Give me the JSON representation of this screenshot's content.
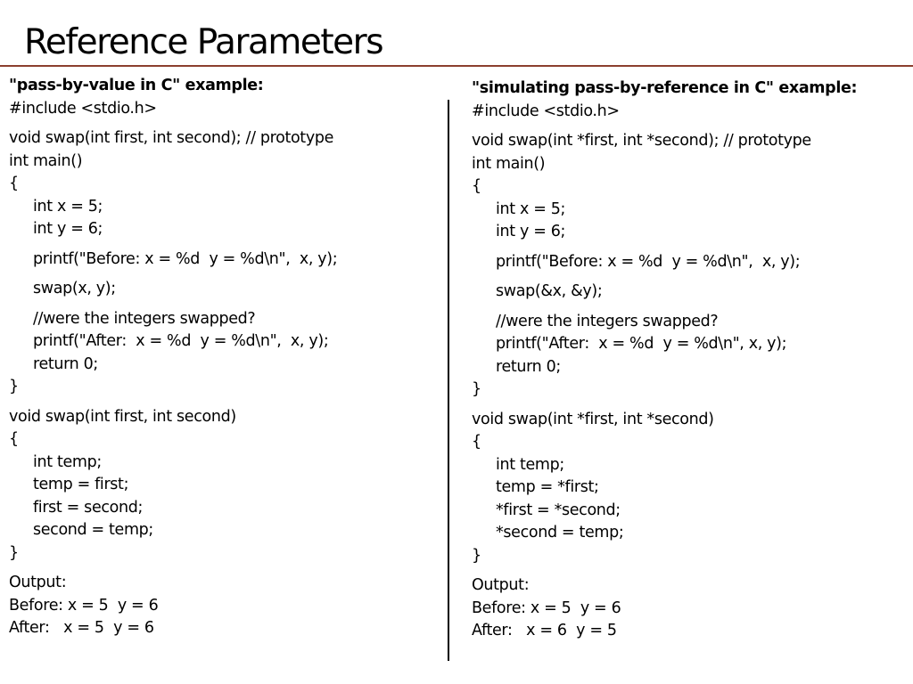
{
  "slide": {
    "title": "Reference Parameters",
    "colors": {
      "title_rule": "#8b3f2e",
      "text": "#000000",
      "background": "#ffffff"
    }
  },
  "columns": [
    {
      "heading": "\"pass-by-value in C\" example:",
      "lines": [
        {
          "text": "#include <stdio.h>",
          "indent": 0,
          "gap": false
        },
        {
          "text": "void swap(int first, int second); // prototype",
          "indent": 0,
          "gap": true
        },
        {
          "text": "int main()",
          "indent": 0,
          "gap": false
        },
        {
          "text": "{",
          "indent": 0,
          "gap": false
        },
        {
          "text": "int x = 5;",
          "indent": 1,
          "gap": false
        },
        {
          "text": "int y = 6;",
          "indent": 1,
          "gap": false
        },
        {
          "text": "printf(\"Before: x = %d  y = %d\\n\",  x, y);",
          "indent": 1,
          "gap": true
        },
        {
          "text": "swap(x, y);",
          "indent": 1,
          "gap": true
        },
        {
          "text": "//were the integers swapped?",
          "indent": 1,
          "gap": true
        },
        {
          "text": "printf(\"After:  x = %d  y = %d\\n\",  x, y);",
          "indent": 1,
          "gap": false
        },
        {
          "text": "return 0;",
          "indent": 1,
          "gap": false
        },
        {
          "text": "}",
          "indent": 0,
          "gap": false
        },
        {
          "text": "void swap(int first, int second)",
          "indent": 0,
          "gap": true
        },
        {
          "text": "{",
          "indent": 0,
          "gap": false
        },
        {
          "text": "int temp;",
          "indent": 1,
          "gap": false
        },
        {
          "text": "temp = first;",
          "indent": 1,
          "gap": false
        },
        {
          "text": "first = second;",
          "indent": 1,
          "gap": false
        },
        {
          "text": "second = temp;",
          "indent": 1,
          "gap": false
        },
        {
          "text": "}",
          "indent": 0,
          "gap": false
        },
        {
          "text": "Output:",
          "indent": 0,
          "gap": true
        },
        {
          "text": "Before: x = 5  y = 6",
          "indent": 0,
          "gap": false
        },
        {
          "text": "After:   x = 5  y = 6",
          "indent": 0,
          "gap": false
        }
      ]
    },
    {
      "heading": "\"simulating pass-by-reference in C\" example:",
      "lines": [
        {
          "text": "#include <stdio.h>",
          "indent": 0,
          "gap": false
        },
        {
          "text": "void swap(int *first, int *second); // prototype",
          "indent": 0,
          "gap": true
        },
        {
          "text": "int main()",
          "indent": 0,
          "gap": false
        },
        {
          "text": "{",
          "indent": 0,
          "gap": false
        },
        {
          "text": "int x = 5;",
          "indent": 1,
          "gap": false
        },
        {
          "text": "int y = 6;",
          "indent": 1,
          "gap": false
        },
        {
          "text": "printf(\"Before: x = %d  y = %d\\n\",  x, y);",
          "indent": 1,
          "gap": true
        },
        {
          "text": "swap(&x, &y);",
          "indent": 1,
          "gap": true
        },
        {
          "text": "//were the integers swapped?",
          "indent": 1,
          "gap": true
        },
        {
          "text": "printf(\"After:  x = %d  y = %d\\n\", x, y);",
          "indent": 1,
          "gap": false
        },
        {
          "text": "return 0;",
          "indent": 1,
          "gap": false
        },
        {
          "text": "}",
          "indent": 0,
          "gap": false
        },
        {
          "text": "void swap(int *first, int *second)",
          "indent": 0,
          "gap": true
        },
        {
          "text": "{",
          "indent": 0,
          "gap": false
        },
        {
          "text": "int temp;",
          "indent": 1,
          "gap": false
        },
        {
          "text": "temp = *first;",
          "indent": 1,
          "gap": false
        },
        {
          "text": "*first = *second;",
          "indent": 1,
          "gap": false
        },
        {
          "text": "*second = temp;",
          "indent": 1,
          "gap": false
        },
        {
          "text": "}",
          "indent": 0,
          "gap": false
        },
        {
          "text": "Output:",
          "indent": 0,
          "gap": true
        },
        {
          "text": "Before: x = 5  y = 6",
          "indent": 0,
          "gap": false
        },
        {
          "text": "After:   x = 6  y = 5",
          "indent": 0,
          "gap": false
        }
      ]
    }
  ]
}
